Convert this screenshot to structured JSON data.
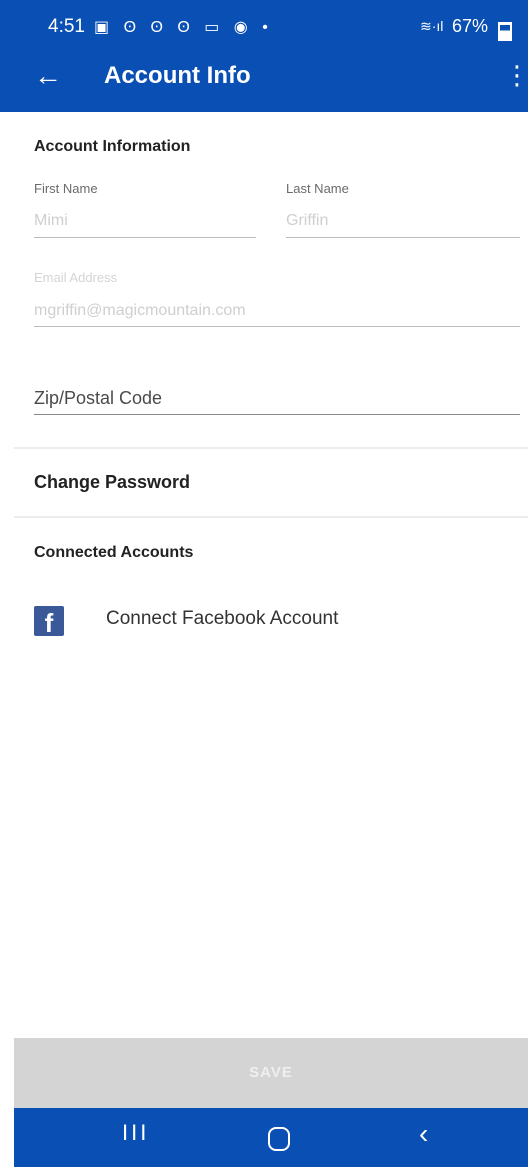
{
  "status_bar": {
    "time": "4:51",
    "notification_icons": "▣ ʘ ʘ ʘ ▭ ◉ •",
    "signal": "≋·ıl",
    "battery_percent": "67%"
  },
  "app_bar": {
    "back_icon": "arrow-left-icon",
    "title": "Account Info",
    "overflow_icon": "more-vertical-icon"
  },
  "form": {
    "section_account": "Account Information",
    "first_name_label": "First Name",
    "first_name_value": "Mimi",
    "last_name_label": "Last Name",
    "last_name_value": "Griffin",
    "email_label": "Email Address",
    "email_value": "mgriffin@magicmountain.com",
    "zip_placeholder": "Zip/Postal Code",
    "change_password": "Change Password",
    "section_connected": "Connected Accounts",
    "facebook_label": "Connect Facebook Account",
    "facebook_glyph": "f"
  },
  "footer": {
    "save_label": "SAVE"
  },
  "nav": {
    "recent": "III",
    "back": "‹"
  },
  "colors": {
    "primary": "#0a4fb3",
    "facebook": "#3b5998",
    "save_disabled": "#d4d4d4"
  }
}
